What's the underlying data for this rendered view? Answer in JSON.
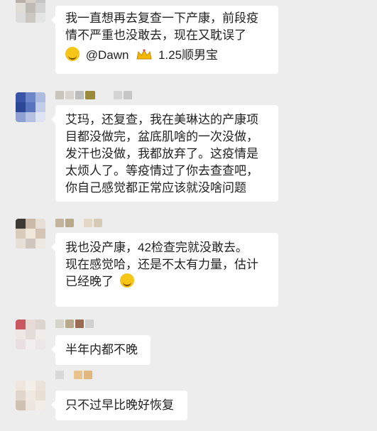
{
  "messages": [
    {
      "id": "msg-1",
      "lines": [
        "我一直想再去复查一下产康，前段疫",
        "情不严重也没敢去，现在又耽误了"
      ],
      "reply": {
        "emoji": "laughing-crying-emoji",
        "mention": "@Dawn",
        "badge": "crown-icon",
        "target": "1.25顺男宝"
      }
    },
    {
      "id": "msg-2",
      "lines": [
        "艾玛，还复查，我在美琳达的产康项",
        "目都没做完，盆底肌啥的一次没做，",
        "发汗也没做，我都放弃了。这疫情是",
        "太烦人了。等疫情过了你去查查吧，",
        "你自己感觉都正常应该就没啥问题"
      ]
    },
    {
      "id": "msg-3",
      "lines": [
        "我也没产康，42检查完就没敢去。",
        "现在感觉哈，还是不太有力量，估计",
        "已经晚了"
      ],
      "trailing_emoji": "laughing-crying-emoji"
    },
    {
      "id": "msg-4",
      "lines": [
        "半年内都不晚"
      ]
    },
    {
      "id": "msg-5",
      "lines": [
        "只不过早比晚好恢复"
      ]
    }
  ],
  "colors": {
    "background": "#ededed",
    "bubble": "#ffffff",
    "text": "#222222",
    "emoji": "#f5c518"
  }
}
